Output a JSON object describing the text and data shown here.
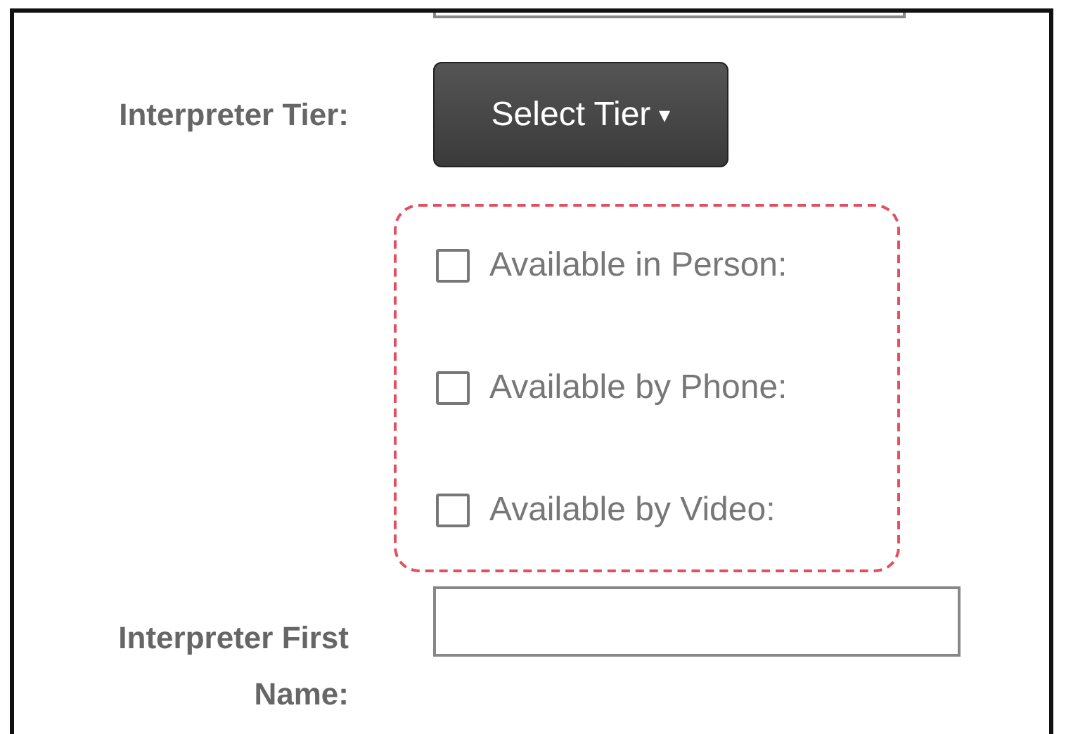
{
  "tier": {
    "label": "Interpreter Tier:",
    "button": "Select Tier",
    "caret": "▾"
  },
  "availability": [
    {
      "label": "Available in Person:",
      "checked": false
    },
    {
      "label": "Available by Phone:",
      "checked": false
    },
    {
      "label": "Available by Video:",
      "checked": false
    }
  ],
  "first_name": {
    "label": "Interpreter First Name:"
  }
}
